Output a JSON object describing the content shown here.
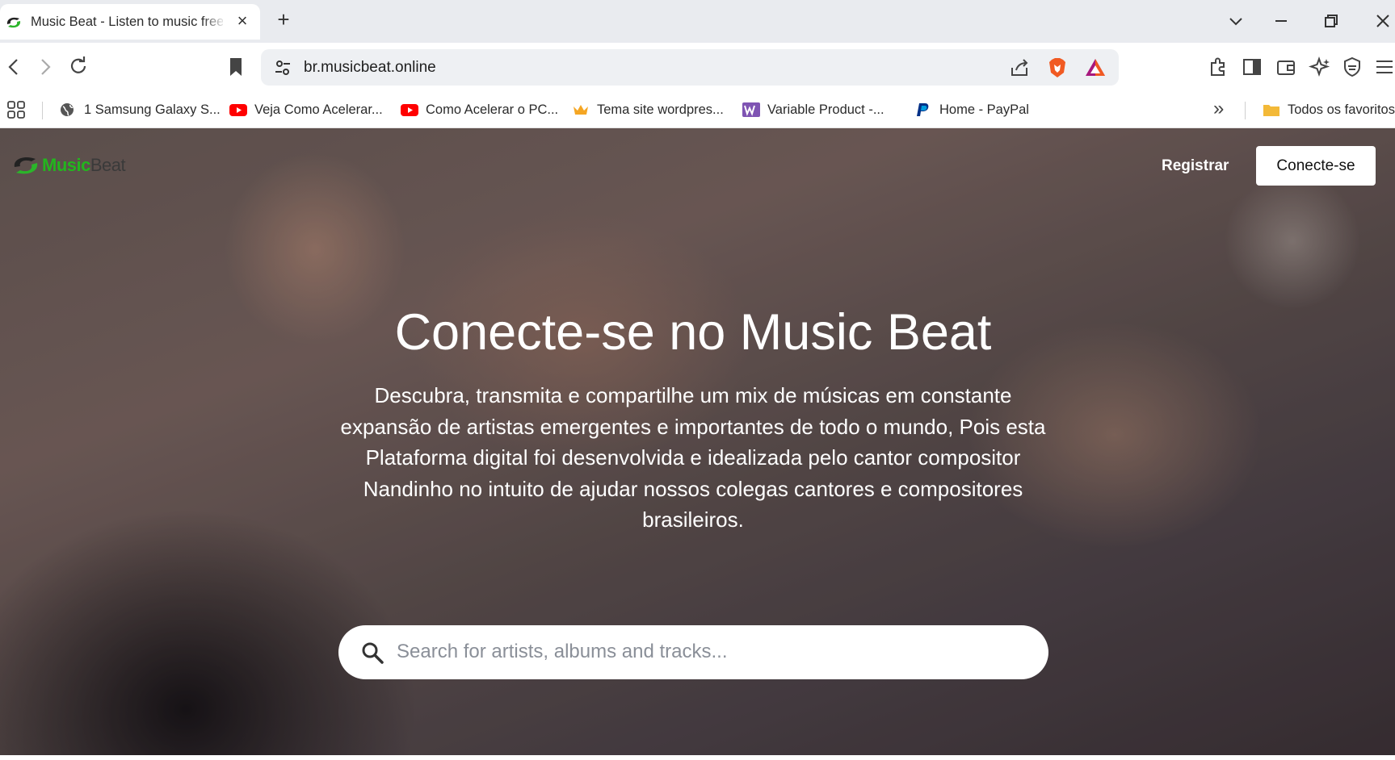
{
  "browser": {
    "tab": {
      "title": "Music Beat - Listen to music free"
    },
    "address": {
      "url": "br.musicbeat.online"
    },
    "bookmarks": [
      {
        "label": "1 Samsung Galaxy S...",
        "icon": "globe-icon"
      },
      {
        "label": "Veja Como Acelerar...",
        "icon": "youtube-icon"
      },
      {
        "label": "Como Acelerar o PC...",
        "icon": "youtube-icon"
      },
      {
        "label": "Tema site wordpres...",
        "icon": "crown-icon"
      },
      {
        "label": "Variable Product -...",
        "icon": "woocommerce-icon"
      },
      {
        "label": "Home - PayPal",
        "icon": "paypal-icon"
      }
    ],
    "bookmarks_overflow": "»",
    "all_bookmarks": "Todos os favoritos"
  },
  "page": {
    "logo": {
      "part1": "Music",
      "part2": "Beat"
    },
    "nav": {
      "register": "Registrar",
      "connect": "Conecte-se"
    },
    "hero": {
      "title": "Conecte-se no Music Beat",
      "description": "Descubra, transmita e compartilhe um mix de músicas em constante expansão de artistas emergentes e importantes de todo o mundo, Pois esta Plataforma digital foi desenvolvida e idealizada pelo cantor compositor Nandinho no intuito de ajudar nossos colegas cantores e compositores brasileiros."
    },
    "search": {
      "placeholder": "Search for artists, albums and tracks...",
      "value": ""
    }
  },
  "colors": {
    "logo_green": "#23b61e",
    "brave_orange": "#f15a22",
    "youtube_red": "#ff0000"
  }
}
